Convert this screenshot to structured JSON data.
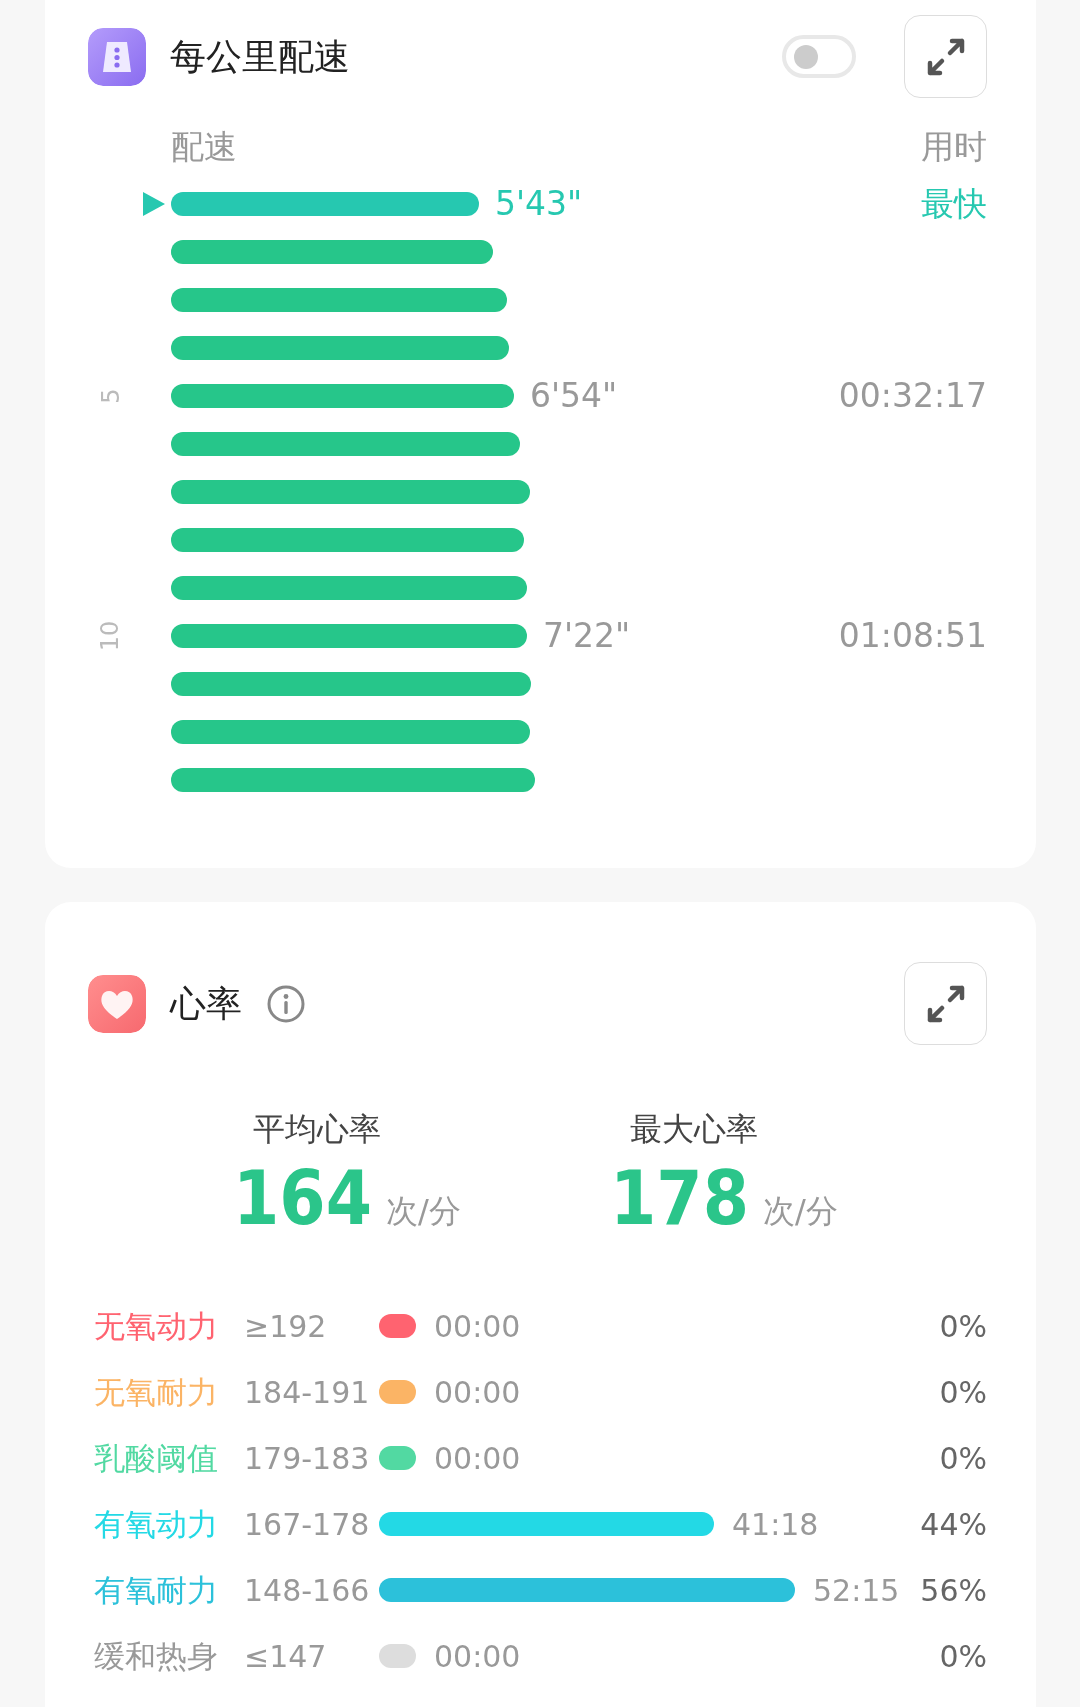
{
  "pace_card": {
    "title": "每公里配速",
    "toggle": {
      "on": false
    },
    "columns": [
      "配速",
      "用时"
    ],
    "rows": [
      {
        "fastest": true,
        "pace": "5'43\"",
        "time": "最快"
      },
      {
        "fastest": false
      },
      {
        "fastest": false
      },
      {
        "fastest": false
      },
      {
        "fastest": false,
        "marker": "5",
        "pace": "6'54\"",
        "time": "00:32:17"
      },
      {
        "fastest": false
      },
      {
        "fastest": false
      },
      {
        "fastest": false
      },
      {
        "fastest": false
      },
      {
        "fastest": false,
        "marker": "10",
        "pace": "7'22\"",
        "time": "01:08:51"
      },
      {
        "fastest": false
      },
      {
        "fastest": false
      },
      {
        "fastest": false
      }
    ]
  },
  "heart_card": {
    "title": "心率",
    "stats": [
      {
        "label": "平均心率",
        "value": "164",
        "unit": "次/分"
      },
      {
        "label": "最大心率",
        "value": "178",
        "unit": "次/分"
      }
    ],
    "zones": [
      {
        "name": "无氧动力",
        "range": "≥192",
        "color": "#ff6370",
        "time": "00:00",
        "percent": "0%"
      },
      {
        "name": "无氧耐力",
        "range": "184-191",
        "color": "#fbb465",
        "time": "00:00",
        "percent": "0%"
      },
      {
        "name": "乳酸阈值",
        "range": "179-183",
        "color": "#52d9a2",
        "time": "00:00",
        "percent": "0%"
      },
      {
        "name": "有氧动力",
        "range": "167-178",
        "color": "#23d9e5",
        "time": "41:18",
        "percent": "44%"
      },
      {
        "name": "有氧耐力",
        "range": "148-166",
        "color": "#2cc1da",
        "time": "52:15",
        "percent": "56%"
      },
      {
        "name": "缓和热身",
        "range": "≤147",
        "color": "#dddddd",
        "time": "00:00",
        "percent": "0%"
      }
    ]
  }
}
